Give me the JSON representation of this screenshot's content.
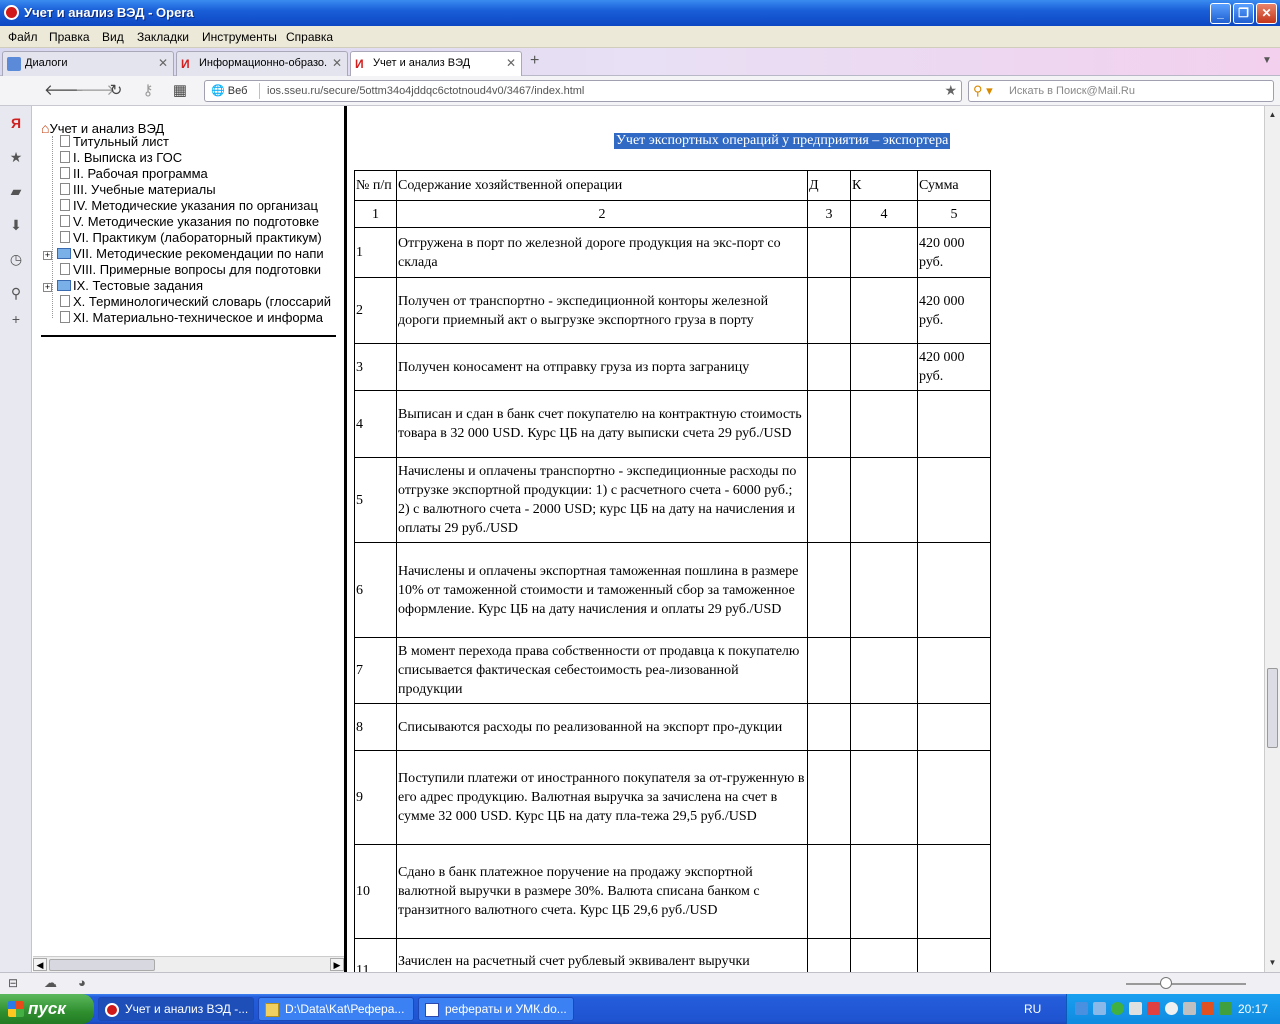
{
  "window": {
    "title": "Учет и анализ ВЭД - Opera"
  },
  "menu": [
    "Файл",
    "Правка",
    "Вид",
    "Закладки",
    "Инструменты",
    "Справка"
  ],
  "tabs": [
    {
      "label": "Диалоги",
      "icon": "dialog-icon"
    },
    {
      "label": "Информационно-образо...",
      "icon": "site-icon"
    },
    {
      "label": "Учет и анализ ВЭД",
      "icon": "site-icon"
    }
  ],
  "navbar": {
    "web_label": "Веб",
    "url": "ios.sseu.ru/secure/5ottm34o4jddqc6ctotnoud4v0/3467/index.html",
    "search_placeholder": "Искать в Поиск@Mail.Ru"
  },
  "toc": {
    "root": "Учет и анализ ВЭД",
    "items": [
      {
        "label": "Титульный лист",
        "type": "doc"
      },
      {
        "label": "I. Выписка из ГОС",
        "type": "doc"
      },
      {
        "label": "II. Рабочая программа",
        "type": "doc"
      },
      {
        "label": "III. Учебные материалы",
        "type": "doc"
      },
      {
        "label": "IV. Методические указания по организац",
        "type": "doc"
      },
      {
        "label": "V. Методические указания по подготовке",
        "type": "doc"
      },
      {
        "label": "VI. Практикум (лабораторный практикум)",
        "type": "doc"
      },
      {
        "label": "VII. Методические рекомендации по напи",
        "type": "folder"
      },
      {
        "label": "VIII. Примерные вопросы для подготовки",
        "type": "doc"
      },
      {
        "label": "IX. Тестовые задания",
        "type": "folder"
      },
      {
        "label": "X. Терминологический словарь (глоссарий",
        "type": "doc"
      },
      {
        "label": "XI. Материально-техническое и информа",
        "type": "doc"
      }
    ]
  },
  "content": {
    "heading": "Учет экспортных операций у предприятия – экспортера",
    "table": {
      "headers": [
        "№ п/п",
        "Содержание хозяйственной операции",
        "Д",
        "К",
        "Сумма"
      ],
      "numbering": [
        "1",
        "2",
        "3",
        "4",
        "5"
      ],
      "rows": [
        {
          "n": "1",
          "text": "Отгружена в порт по железной дороге продукция на экс-порт со склада",
          "sum": "420 000 руб."
        },
        {
          "n": "2",
          "text": "Получен  от транспортно - экспедиционной  конторы железной дороги приемный акт о выгрузке экспортного груза в порту",
          "sum": "420 000 руб."
        },
        {
          "n": "3",
          "text": "Получен коносамент на отправку груза из порта заграницу",
          "sum": "420 000 руб."
        },
        {
          "n": "4",
          "text": "Выписан и сдан в банк счет покупателю на контрактную стоимость товара в 32 000 USD. Курс ЦБ на дату выписки счета 29 руб./USD",
          "sum": ""
        },
        {
          "n": "5",
          "text": "Начислены и оплачены транспортно - экспедиционные расходы по отгрузке экспортной продукции: 1) с расчетного счета - 6000 руб.; 2) с валютного счета - 2000 USD; курс ЦБ на дату на начисления и оплаты 29 руб./USD",
          "sum": ""
        },
        {
          "n": "6",
          "text": "Начислены и оплачены экспортная таможенная пошлина в размере 10% от таможенной стоимости и таможенный сбор за таможенное оформление. Курс ЦБ на дату начисления и оплаты 29 руб./USD",
          "sum": ""
        },
        {
          "n": "7",
          "text": "В момент перехода права собственности от продавца к покупателю списывается фактическая себестоимость реа-лизованной продукции",
          "sum": ""
        },
        {
          "n": "8",
          "text": "Списываются расходы по реализованной на экспорт про-дукции",
          "sum": ""
        },
        {
          "n": "9",
          "text": "Поступили платежи от иностранного покупателя за от-груженную в его адрес продукцию. Валютная выручка за зачислена на счет в сумме 32 000 USD. Курс ЦБ на дату пла-тежа 29,5 руб./USD",
          "sum": ""
        },
        {
          "n": "10",
          "text": "Сдано в банк платежное поручение на продажу экспортной валютной выручки в размере 30%. Валюта списана банком с транзитного валютного счета. Курс ЦБ 29,6 руб./USD",
          "sum": ""
        },
        {
          "n": "11",
          "text": "Зачислен на расчетный счет рублевый эквивалент выручки",
          "sum": ""
        }
      ]
    }
  },
  "taskbar": {
    "start_label": "пуск",
    "tasks": [
      {
        "label": "Учет и анализ ВЭД -...",
        "icon": "opera-icon"
      },
      {
        "label": "D:\\Data\\Kat\\Рефера...",
        "icon": "folder-icon"
      },
      {
        "label": "рефераты и УМК.do...",
        "icon": "word-icon"
      }
    ],
    "lang": "RU",
    "clock": "20:17"
  },
  "colors": {
    "selection": "#316ac5",
    "titlebar": "#0c47c2",
    "taskbar": "#245ddb"
  }
}
